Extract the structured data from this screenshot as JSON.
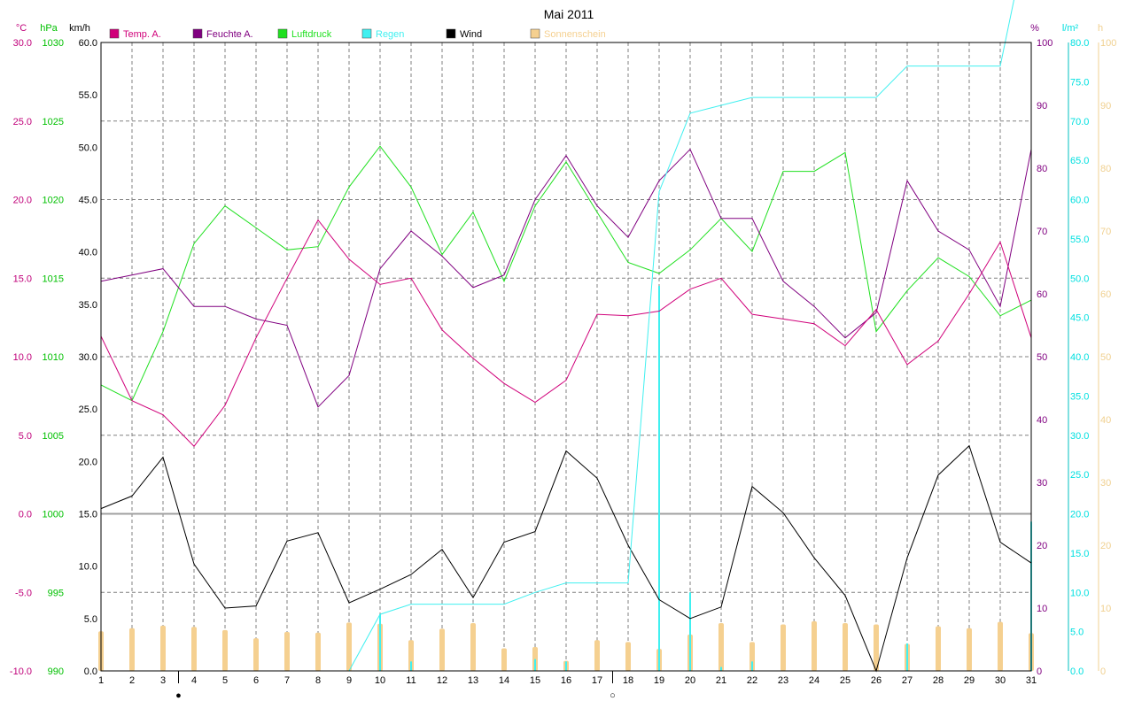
{
  "chart_data": {
    "type": "line",
    "title": "Mai 2011",
    "x": [
      1,
      2,
      3,
      4,
      5,
      6,
      7,
      8,
      9,
      10,
      11,
      12,
      13,
      14,
      15,
      16,
      17,
      18,
      19,
      20,
      21,
      22,
      23,
      24,
      25,
      26,
      27,
      28,
      29,
      30,
      31
    ],
    "axes": {
      "temp": {
        "unit": "°C",
        "color": "#c0007a",
        "ylim": [
          -10,
          30
        ],
        "ticks": [
          "-10.0",
          "-5.0",
          "0.0",
          "5.0",
          "10.0",
          "15.0",
          "20.0",
          "25.0",
          "30.0"
        ]
      },
      "pressure": {
        "unit": "hPa",
        "color": "#00c000",
        "ylim": [
          990,
          1030
        ],
        "ticks": [
          "990",
          "995",
          "1000",
          "1005",
          "1010",
          "1015",
          "1020",
          "1025",
          "1030"
        ]
      },
      "wind": {
        "unit": "km/h",
        "color": "#000000",
        "ylim": [
          0,
          60
        ],
        "ticks": [
          "0.0",
          "5.0",
          "10.0",
          "15.0",
          "20.0",
          "25.0",
          "30.0",
          "35.0",
          "40.0",
          "45.0",
          "50.0",
          "55.0",
          "60.0"
        ]
      },
      "humidity": {
        "unit": "%",
        "color": "#800080",
        "ylim": [
          0,
          100
        ],
        "ticks": [
          "0",
          "10",
          "20",
          "30",
          "40",
          "50",
          "60",
          "70",
          "80",
          "90",
          "100"
        ]
      },
      "rain": {
        "unit": "l/m²",
        "color": "#00e0e0",
        "ylim": [
          0,
          80
        ],
        "ticks": [
          "0.0",
          "5.0",
          "10.0",
          "15.0",
          "20.0",
          "25.0",
          "30.0",
          "35.0",
          "40.0",
          "45.0",
          "50.0",
          "55.0",
          "60.0",
          "65.0",
          "70.0",
          "75.0",
          "80.0"
        ]
      },
      "sun": {
        "unit": "h",
        "color": "#f0d090",
        "ylim": [
          0,
          100
        ],
        "ticks": [
          "0",
          "10",
          "20",
          "30",
          "40",
          "50",
          "60",
          "70",
          "80",
          "90",
          "100"
        ]
      }
    },
    "series": [
      {
        "name": "Temp. A.",
        "axis": "temp",
        "color": "#d0007a",
        "values": [
          11.3,
          7.2,
          6.3,
          4.3,
          6.9,
          11.2,
          15.0,
          18.7,
          16.2,
          14.6,
          15.0,
          11.7,
          9.9,
          8.3,
          7.1,
          8.5,
          12.7,
          12.6,
          12.9,
          14.3,
          15.0,
          12.7,
          12.4,
          12.1,
          10.7,
          13.0,
          9.5,
          11.0,
          14.0,
          17.3,
          11.2
        ]
      },
      {
        "name": "Feuchte A.",
        "axis": "humidity",
        "color": "#800080",
        "values": [
          62,
          63,
          64,
          58,
          58,
          56,
          55,
          42,
          47,
          64,
          70,
          66,
          61,
          63,
          75,
          82,
          74,
          69,
          78,
          83,
          72,
          72,
          62,
          58,
          53,
          57,
          78,
          70,
          67,
          58,
          83
        ]
      },
      {
        "name": "Luftdruck",
        "axis": "pressure",
        "color": "#20e020",
        "values": [
          1008.2,
          1007.2,
          1011.6,
          1017.2,
          1019.6,
          1018.2,
          1016.8,
          1017.0,
          1020.8,
          1023.4,
          1020.8,
          1016.5,
          1019.2,
          1014.8,
          1019.6,
          1022.4,
          1019.2,
          1016.0,
          1015.3,
          1016.8,
          1018.8,
          1016.7,
          1021.8,
          1021.8,
          1023.0,
          1011.6,
          1014.2,
          1016.3,
          1015.1,
          1012.6,
          1013.6
        ]
      },
      {
        "name": "Regen",
        "axis": "rain",
        "color": "#40f0f0",
        "values": [
          null,
          null,
          null,
          null,
          null,
          null,
          null,
          null,
          0.0,
          7.2,
          8.5,
          8.5,
          8.5,
          8.5,
          10.0,
          11.2,
          11.2,
          11.2,
          61.0,
          71.0,
          72.0,
          73.0,
          73.0,
          73.0,
          73.0,
          73.0,
          77.0,
          77.0,
          77.0,
          77.0,
          96.0
        ],
        "daily": [
          0,
          0,
          0,
          0,
          0,
          0,
          0,
          0,
          0,
          7.2,
          1.2,
          0,
          0,
          0,
          1.5,
          1.2,
          0,
          0,
          49.0,
          10.0,
          0.5,
          1.2,
          0,
          0,
          0,
          0,
          3.5,
          0,
          0,
          0,
          19.0
        ]
      },
      {
        "name": "Wind",
        "axis": "wind",
        "color": "#000000",
        "values": [
          15.5,
          16.7,
          20.4,
          10.2,
          6.0,
          6.2,
          12.4,
          13.2,
          6.5,
          7.8,
          9.2,
          11.6,
          7.0,
          12.3,
          13.3,
          21.0,
          18.4,
          12.0,
          6.8,
          5.0,
          6.1,
          17.6,
          15.1,
          10.8,
          7.2,
          0.0,
          10.8,
          18.7,
          21.5,
          12.3,
          10.3
        ]
      },
      {
        "name": "Sonnenschein",
        "axis": "sun",
        "color": "#f5d090",
        "values": [
          6.3,
          6.8,
          7.2,
          7.0,
          6.5,
          5.2,
          6.2,
          6.1,
          7.7,
          7.5,
          4.9,
          6.7,
          7.6,
          3.6,
          3.8,
          1.6,
          4.9,
          4.6,
          3.5,
          5.8,
          7.6,
          4.6,
          7.4,
          7.9,
          7.6,
          7.4,
          4.3,
          7.1,
          6.8,
          7.8,
          6.0
        ]
      }
    ],
    "moon_phases": [
      {
        "day": 3.5,
        "symbol": "●"
      },
      {
        "day": 17.5,
        "symbol": "○"
      }
    ],
    "grid": true,
    "legend": "top"
  }
}
